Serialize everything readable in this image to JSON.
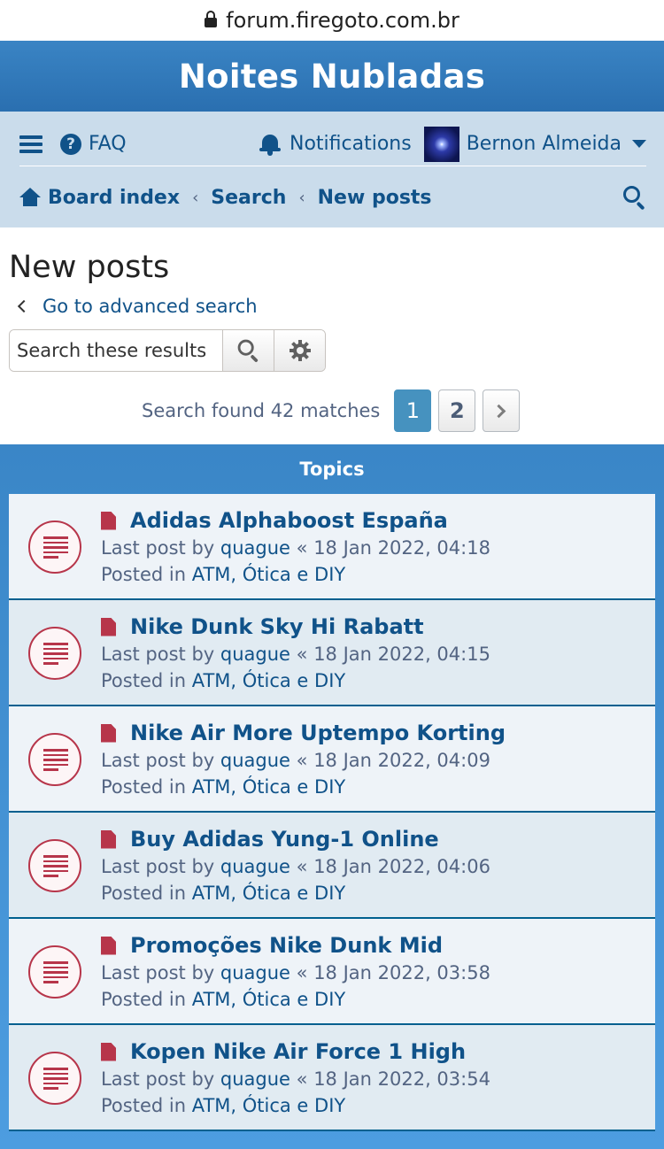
{
  "browser": {
    "url": "forum.firegoto.com.br"
  },
  "header": {
    "site_title": "Noites Nubladas"
  },
  "nav": {
    "faq": "FAQ",
    "notifications": "Notifications",
    "username": "Bernon Almeida",
    "breadcrumbs": [
      "Board index",
      "Search",
      "New posts"
    ]
  },
  "page": {
    "title": "New posts",
    "advanced_search": "Go to advanced search",
    "search_placeholder": "Search these results",
    "found_text": "Search found 42 matches",
    "pages": [
      "1",
      "2"
    ],
    "current_page": "1"
  },
  "topics": {
    "header": "Topics",
    "last_post_prefix": "Last post by",
    "posted_in_prefix": "Posted in",
    "items": [
      {
        "title": "Adidas Alphaboost España",
        "author": "quague",
        "date": "« 18 Jan 2022, 04:18",
        "forum": "ATM, Ótica e DIY"
      },
      {
        "title": "Nike Dunk Sky Hi Rabatt",
        "author": "quague",
        "date": "« 18 Jan 2022, 04:15",
        "forum": "ATM, Ótica e DIY"
      },
      {
        "title": "Nike Air More Uptempo Korting",
        "author": "quague",
        "date": "« 18 Jan 2022, 04:09",
        "forum": "ATM, Ótica e DIY"
      },
      {
        "title": "Buy Adidas Yung-1 Online",
        "author": "quague",
        "date": "« 18 Jan 2022, 04:06",
        "forum": "ATM, Ótica e DIY"
      },
      {
        "title": "Promoções Nike Dunk Mid",
        "author": "quague",
        "date": "« 18 Jan 2022, 03:58",
        "forum": "ATM, Ótica e DIY"
      },
      {
        "title": "Kopen Nike Air Force 1 High",
        "author": "quague",
        "date": "« 18 Jan 2022, 03:54",
        "forum": "ATM, Ótica e DIY"
      }
    ]
  },
  "colors": {
    "header_blue": "#2a6fb0",
    "nav_bg": "#cadceb",
    "link": "#105289",
    "unread_red": "#b7354a",
    "page_active": "#4692bf"
  },
  "icons": [
    "lock-icon",
    "hamburger-icon",
    "faq-icon",
    "bell-icon",
    "avatar",
    "caret-down-icon",
    "home-icon",
    "search-icon",
    "chevron-left-icon",
    "gear-icon",
    "chevron-right-icon",
    "topic-unread-icon",
    "file-icon"
  ]
}
